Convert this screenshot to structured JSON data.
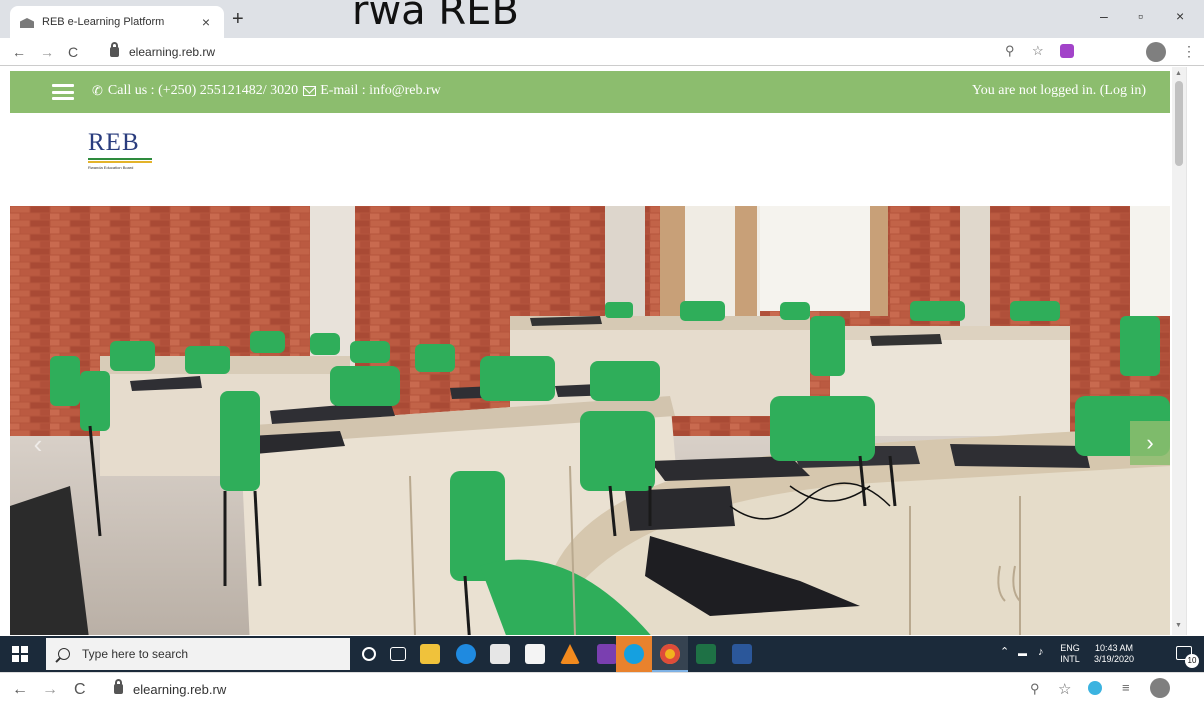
{
  "overlay_title": "rwa REB",
  "browser": {
    "tab_title": "REB e-Learning Platform",
    "tab_close": "×",
    "new_tab": "+",
    "url": "elearning.reb.rw",
    "back": "←",
    "forward": "→",
    "reload": "C",
    "zoom_icon": "magnifier-icon",
    "star": "☆",
    "menu": "⋮",
    "win_minimize": "–",
    "win_restore": "▫",
    "win_close": "×"
  },
  "site": {
    "contact_text": "Call us : (+250) 255121482/ 3020",
    "email_text": "E-mail : info@reb.rw",
    "login_status": "You are not logged in. (Log in)",
    "logo_text": "REB",
    "logo_subtitle": "Rwanda Education Board",
    "slider_prev": "‹",
    "slider_next": "›",
    "colors": {
      "topbar": "#8cbd6e",
      "logo": "#2a3d7e"
    }
  },
  "taskbar": {
    "search_placeholder": "Type here to search",
    "lang_top": "ENG",
    "lang_bottom": "INTL",
    "time": "10:43 AM",
    "date": "3/19/2020",
    "notifications": "10"
  },
  "bottom_bar": {
    "url": "elearning.reb.rw",
    "back": "←",
    "forward": "→",
    "reload": "C"
  }
}
